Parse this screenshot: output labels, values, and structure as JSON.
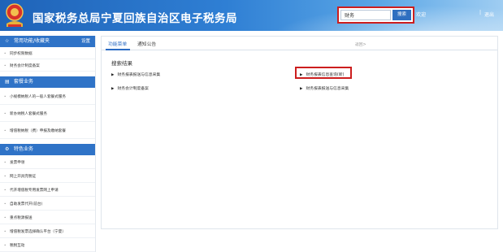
{
  "header": {
    "site_title": "国家税务总局宁夏回族自治区电子税务局",
    "search_value": "财务",
    "search_button": "搜索",
    "link_truncated": "欢迎",
    "logout": "退出",
    "separator": "|"
  },
  "sidebar": {
    "common": {
      "title": "常用功能/收藏夹",
      "settings": "设置",
      "icon": "star-icon",
      "items": [
        "同步权限数据",
        "财务会计制度备案"
      ]
    },
    "declare": {
      "title": "套餐业务",
      "icon": "package-icon",
      "items": [
        "小规模纳税人的一般人套餐式服务",
        "新办纳税人套餐式服务",
        "增值税纳税（费）申报及缴纳套餐"
      ]
    },
    "special": {
      "title": "特色业务",
      "icon": "gear-icon",
      "items": [
        "发票申领",
        "网上开具完税证",
        "代开增值税专用发票网上申请",
        "自助发票代开(前台)",
        "重点税源报送",
        "增值税发票选择确认平台（宁夏）",
        "税税互动"
      ]
    }
  },
  "main": {
    "tabs": [
      "功能菜单",
      "通知公告"
    ],
    "back_link": "返回>",
    "results_title": "搜索结果",
    "results": [
      "财务报表报送与信息采集",
      "财务报表信息查询(新)",
      "财务会计制度备案",
      "财务报表报送与信息采集"
    ]
  },
  "colors": {
    "header_blue": "#2f7fd4",
    "section_blue": "#2f73c7",
    "highlight_red": "#cc1e1e",
    "tab_active": "#2a6bc4"
  }
}
